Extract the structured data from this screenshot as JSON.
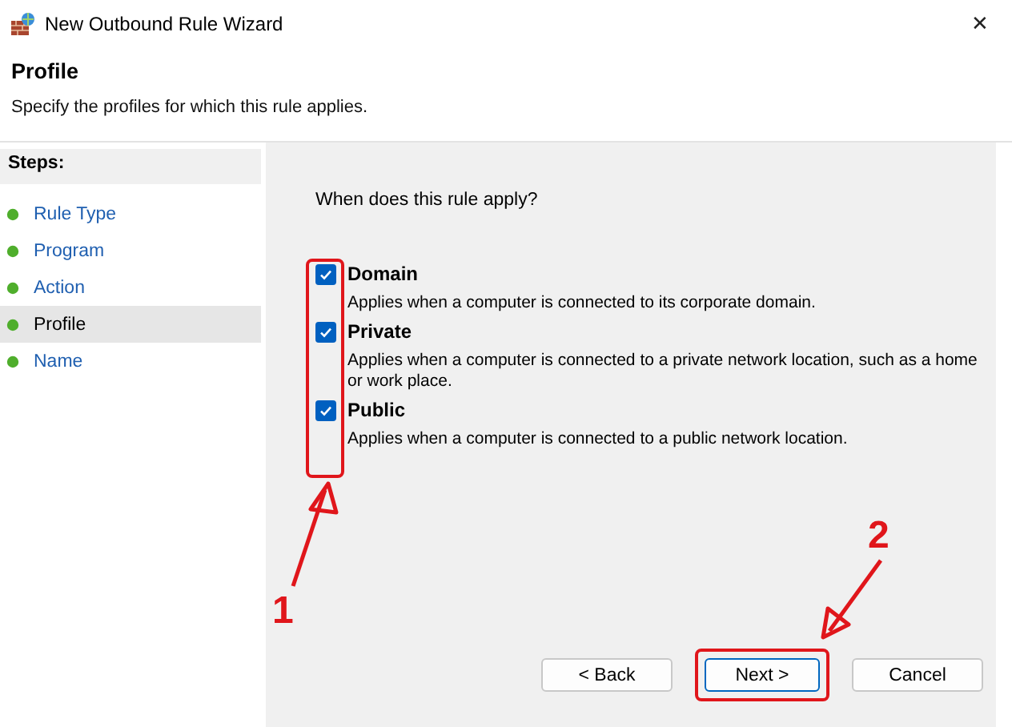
{
  "window": {
    "title": "New Outbound Rule Wizard",
    "close": "✕"
  },
  "header": {
    "title": "Profile",
    "subtitle": "Specify the profiles for which this rule applies."
  },
  "steps": {
    "heading": "Steps:",
    "items": [
      {
        "label": "Rule Type",
        "selected": false
      },
      {
        "label": "Program",
        "selected": false
      },
      {
        "label": "Action",
        "selected": false
      },
      {
        "label": "Profile",
        "selected": true
      },
      {
        "label": "Name",
        "selected": false
      }
    ]
  },
  "question": "When does this rule apply?",
  "options": [
    {
      "label": "Domain",
      "description": "Applies when a computer is connected to its corporate domain.",
      "checked": true
    },
    {
      "label": "Private",
      "description": "Applies when a computer is connected to a private network location, such as a home or work place.",
      "checked": true
    },
    {
      "label": "Public",
      "description": "Applies when a computer is connected to a public network location.",
      "checked": true
    }
  ],
  "buttons": [
    {
      "label": "< Back",
      "highlighted": false
    },
    {
      "label": "Next >",
      "highlighted": true
    },
    {
      "label": "Cancel",
      "highlighted": false
    }
  ],
  "callouts": [
    {
      "number": "1"
    },
    {
      "number": "2"
    }
  ]
}
